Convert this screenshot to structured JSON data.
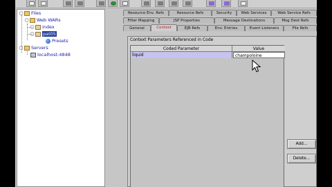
{
  "toolbar": {
    "buttons": [
      {
        "name": "new-file-icon"
      },
      {
        "name": "new-doc-icon"
      },
      {
        "name": "cut-icon"
      },
      {
        "name": "copy-icon"
      },
      {
        "name": "deploy-icon"
      },
      {
        "name": "properties-icon"
      },
      {
        "name": "run-icon"
      },
      {
        "name": "validate-icon"
      },
      {
        "name": "tool-a-icon"
      },
      {
        "name": "tool-b-icon"
      },
      {
        "name": "tool-c-icon"
      },
      {
        "name": "verify-icon"
      }
    ]
  },
  "tree": {
    "files": "Files",
    "web_wars": "Web WARs",
    "index": "index",
    "selected_war": "pat05",
    "presets": "Presets",
    "servers": "Servers",
    "server_host": "localhost:4848"
  },
  "tabs": {
    "row1": [
      "Resource Env. Refs",
      "Resource Refs",
      "Security",
      "Web Services",
      "Web Service Refs"
    ],
    "row2": [
      "Filter Mapping",
      "JSP Properties",
      "Message Destinations",
      "Msg Dest Refs"
    ],
    "row3": [
      "General",
      "Context",
      "EJB Refs",
      "Env. Entries",
      "Event Listeners",
      "File Refs"
    ],
    "active": "Context"
  },
  "content": {
    "title": "Context Parameters Referenced in Code",
    "columns": [
      "Coded Parameter",
      "Value"
    ],
    "rows": [
      {
        "param": "liquid",
        "value": "champoloine"
      }
    ],
    "add_label": "Add...",
    "delete_label": "Delete..."
  },
  "colors": {
    "selection": "#1f3a9a",
    "active_tab_text": "#b8232e",
    "param_cell": "#c7c3f0"
  }
}
